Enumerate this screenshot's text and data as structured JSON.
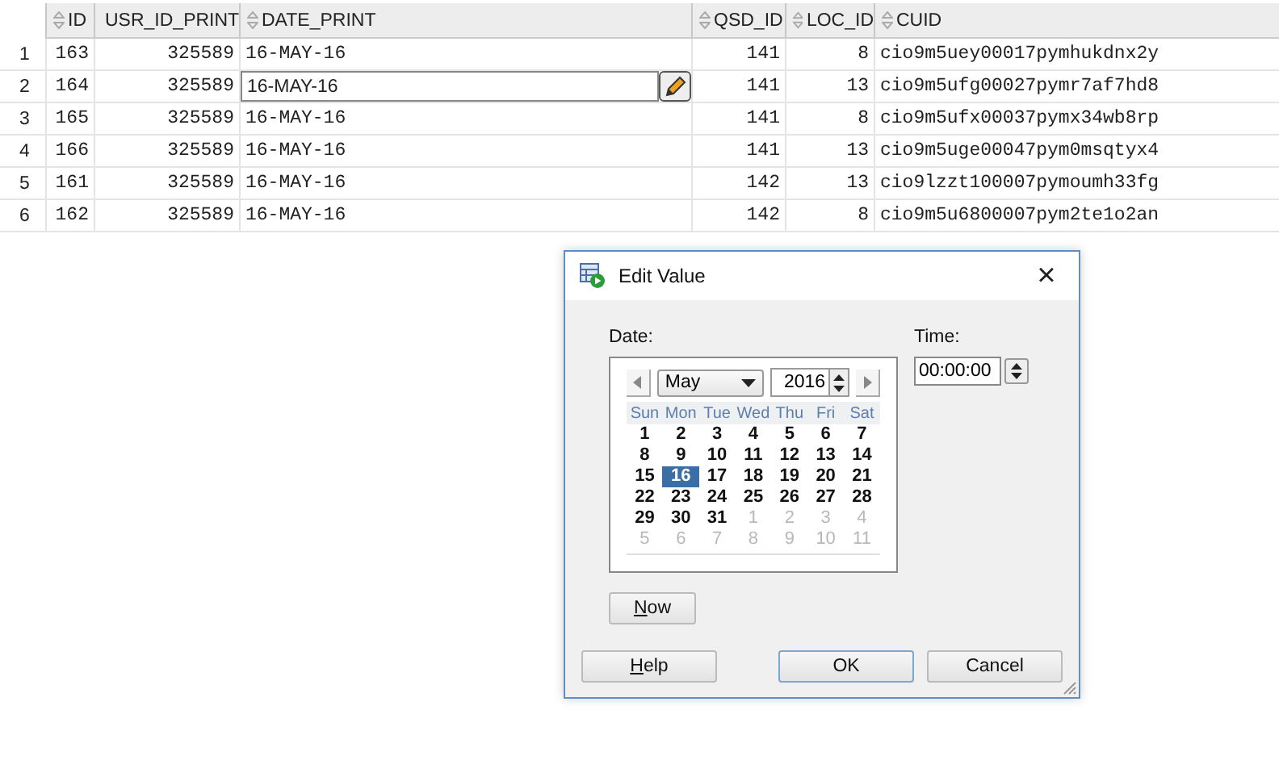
{
  "table": {
    "columns": [
      "ID",
      "USR_ID_PRINT",
      "DATE_PRINT",
      "QSD_ID",
      "LOC_ID",
      "CUID"
    ],
    "rows": [
      {
        "number": "1",
        "editing": false,
        "cells": [
          "163",
          "325589",
          "16-MAY-16",
          "141",
          "8",
          "cio9m5uey00017pymhukdnx2y"
        ]
      },
      {
        "number": "2",
        "editing": true,
        "cells": [
          "164",
          "325589",
          "16-MAY-16",
          "141",
          "13",
          "cio9m5ufg00027pymr7af7hd8"
        ]
      },
      {
        "number": "3",
        "editing": false,
        "cells": [
          "165",
          "325589",
          "16-MAY-16",
          "141",
          "8",
          "cio9m5ufx00037pymx34wb8rp"
        ]
      },
      {
        "number": "4",
        "editing": false,
        "cells": [
          "166",
          "325589",
          "16-MAY-16",
          "141",
          "13",
          "cio9m5uge00047pym0msqtyx4"
        ]
      },
      {
        "number": "5",
        "editing": false,
        "cells": [
          "161",
          "325589",
          "16-MAY-16",
          "142",
          "13",
          "cio9lzzt100007pymoumh33fg"
        ]
      },
      {
        "number": "6",
        "editing": false,
        "cells": [
          "162",
          "325589",
          "16-MAY-16",
          "142",
          "8",
          "cio9m5u6800007pym2te1o2an"
        ]
      }
    ]
  },
  "dialog": {
    "title": "Edit Value",
    "close": "×",
    "date_label": "Date:",
    "month": "May",
    "year": "2016",
    "time_label": "Time:",
    "time": "00:00:00",
    "weekdays": [
      "Sun",
      "Mon",
      "Tue",
      "Wed",
      "Thu",
      "Fri",
      "Sat"
    ],
    "weeks": [
      [
        {
          "label": "1",
          "muted": false,
          "selected": false
        },
        {
          "label": "2",
          "muted": false,
          "selected": false
        },
        {
          "label": "3",
          "muted": false,
          "selected": false
        },
        {
          "label": "4",
          "muted": false,
          "selected": false
        },
        {
          "label": "5",
          "muted": false,
          "selected": false
        },
        {
          "label": "6",
          "muted": false,
          "selected": false
        },
        {
          "label": "7",
          "muted": false,
          "selected": false
        }
      ],
      [
        {
          "label": "8",
          "muted": false,
          "selected": false
        },
        {
          "label": "9",
          "muted": false,
          "selected": false
        },
        {
          "label": "10",
          "muted": false,
          "selected": false
        },
        {
          "label": "11",
          "muted": false,
          "selected": false
        },
        {
          "label": "12",
          "muted": false,
          "selected": false
        },
        {
          "label": "13",
          "muted": false,
          "selected": false
        },
        {
          "label": "14",
          "muted": false,
          "selected": false
        }
      ],
      [
        {
          "label": "15",
          "muted": false,
          "selected": false
        },
        {
          "label": "16",
          "muted": false,
          "selected": true
        },
        {
          "label": "17",
          "muted": false,
          "selected": false
        },
        {
          "label": "18",
          "muted": false,
          "selected": false
        },
        {
          "label": "19",
          "muted": false,
          "selected": false
        },
        {
          "label": "20",
          "muted": false,
          "selected": false
        },
        {
          "label": "21",
          "muted": false,
          "selected": false
        }
      ],
      [
        {
          "label": "22",
          "muted": false,
          "selected": false
        },
        {
          "label": "23",
          "muted": false,
          "selected": false
        },
        {
          "label": "24",
          "muted": false,
          "selected": false
        },
        {
          "label": "25",
          "muted": false,
          "selected": false
        },
        {
          "label": "26",
          "muted": false,
          "selected": false
        },
        {
          "label": "27",
          "muted": false,
          "selected": false
        },
        {
          "label": "28",
          "muted": false,
          "selected": false
        }
      ],
      [
        {
          "label": "29",
          "muted": false,
          "selected": false
        },
        {
          "label": "30",
          "muted": false,
          "selected": false
        },
        {
          "label": "31",
          "muted": false,
          "selected": false
        },
        {
          "label": "1",
          "muted": true,
          "selected": false
        },
        {
          "label": "2",
          "muted": true,
          "selected": false
        },
        {
          "label": "3",
          "muted": true,
          "selected": false
        },
        {
          "label": "4",
          "muted": true,
          "selected": false
        }
      ],
      [
        {
          "label": "5",
          "muted": true,
          "selected": false
        },
        {
          "label": "6",
          "muted": true,
          "selected": false
        },
        {
          "label": "7",
          "muted": true,
          "selected": false
        },
        {
          "label": "8",
          "muted": true,
          "selected": false
        },
        {
          "label": "9",
          "muted": true,
          "selected": false
        },
        {
          "label": "10",
          "muted": true,
          "selected": false
        },
        {
          "label": "11",
          "muted": true,
          "selected": false
        }
      ]
    ],
    "now_button": {
      "label": "Now",
      "mnemonic": true
    },
    "buttons": [
      {
        "label": "Help",
        "mnemonic": true,
        "default": false
      },
      {
        "label": "OK",
        "mnemonic": false,
        "default": true
      },
      {
        "label": "Cancel",
        "mnemonic": false,
        "default": false
      }
    ]
  }
}
